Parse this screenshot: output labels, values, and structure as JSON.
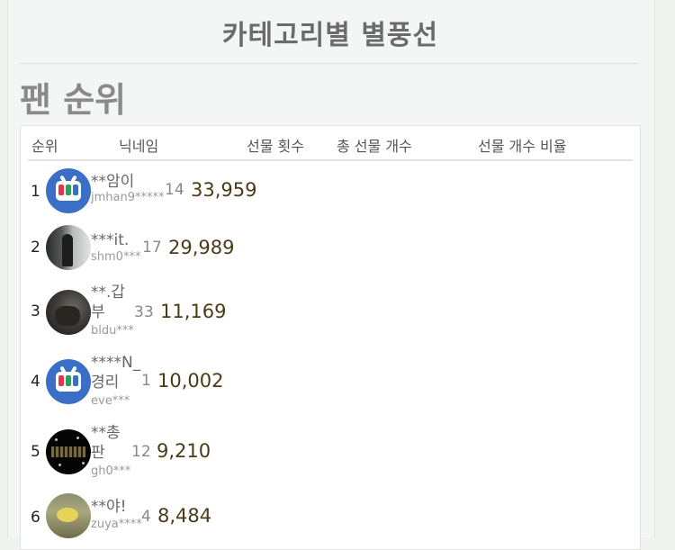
{
  "header": {
    "title": "카테고리별 별풍선"
  },
  "section": {
    "title": "팬 순위"
  },
  "table": {
    "columns": [
      "순위",
      "닉네임",
      "선물 횟수",
      "총 선물 개수",
      "선물 개수 비율"
    ],
    "rows": [
      {
        "rank": "1",
        "nickname": "**암이",
        "user_id": "jmhan9*****",
        "count": "14",
        "amount": "33,959",
        "avatar": "app-icon-avatar"
      },
      {
        "rank": "2",
        "nickname": "***it.",
        "user_id": "shm0***",
        "count": "17",
        "amount": "29,989",
        "avatar": "photo-avatar"
      },
      {
        "rank": "3",
        "nickname": "**.갑부",
        "user_id": "bldu***",
        "count": "33",
        "amount": "11,169",
        "avatar": "photo-avatar"
      },
      {
        "rank": "4",
        "nickname": "****N_경리",
        "user_id": "eve***",
        "count": "1",
        "amount": "10,002",
        "avatar": "app-icon-avatar"
      },
      {
        "rank": "5",
        "nickname": "**총판",
        "user_id": "gh0***",
        "count": "12",
        "amount": "9,210",
        "avatar": "photo-avatar"
      },
      {
        "rank": "6",
        "nickname": "**야!",
        "user_id": "zuya****",
        "count": "4",
        "amount": "8,484",
        "avatar": "photo-avatar"
      }
    ]
  }
}
